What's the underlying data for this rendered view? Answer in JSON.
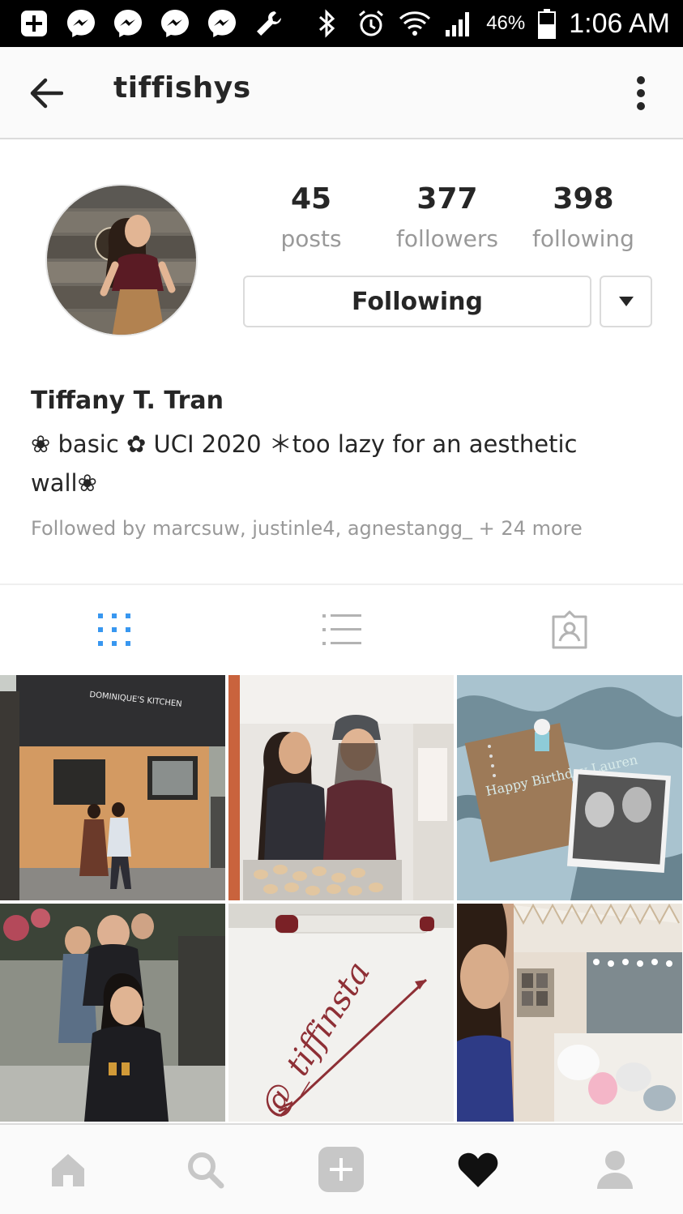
{
  "status_bar": {
    "time": "1:06 AM",
    "battery_percent": "46%",
    "icons": [
      "plus-box-icon",
      "messenger-icon",
      "messenger-icon",
      "messenger-icon",
      "messenger-icon",
      "wrench-icon",
      "bluetooth-icon",
      "alarm-icon",
      "wifi-icon",
      "signal-icon",
      "battery-icon"
    ]
  },
  "app_bar": {
    "username": "tiffishys",
    "back_icon": "arrow-left-icon",
    "more_icon": "more-vertical-icon"
  },
  "profile": {
    "stats": [
      {
        "value": "45",
        "label": "posts"
      },
      {
        "value": "377",
        "label": "followers"
      },
      {
        "value": "398",
        "label": "following"
      }
    ],
    "following_button": "Following",
    "full_name": "Tiffany T. Tran",
    "bio_line1": "❀ basic ✿ UCI 2020 ＊too lazy for an aesthetic",
    "bio_line2": "wall❀",
    "followed_by": "Followed by marcsuw, justinle4, agnestangg_ + 24 more"
  },
  "tabs": [
    {
      "name": "grid-view",
      "icon": "grid-icon",
      "active": true
    },
    {
      "name": "list-view",
      "icon": "list-icon",
      "active": false
    },
    {
      "name": "tagged-view",
      "icon": "tagged-person-icon",
      "active": false
    }
  ],
  "photos": [
    {
      "sign_text": "DOMINIQUE'S KITCHEN"
    },
    {
      "sign_text": ""
    },
    {
      "card_text": "Happy Birthday Lauren"
    },
    {
      "sign_text": ""
    },
    {
      "handwriting": "@_tiffinsta"
    },
    {
      "sign_text": ""
    }
  ],
  "bottom_nav": [
    {
      "name": "home",
      "icon": "home-icon"
    },
    {
      "name": "search",
      "icon": "search-icon"
    },
    {
      "name": "new-post",
      "icon": "plus-square-icon"
    },
    {
      "name": "activity",
      "icon": "heart-icon"
    },
    {
      "name": "profile",
      "icon": "person-icon"
    }
  ],
  "colors": {
    "accent_blue": "#3897f0",
    "text_primary": "#262626",
    "text_secondary": "#999999",
    "border": "#dbdbdb",
    "icon_gray": "#c7c7c7"
  }
}
